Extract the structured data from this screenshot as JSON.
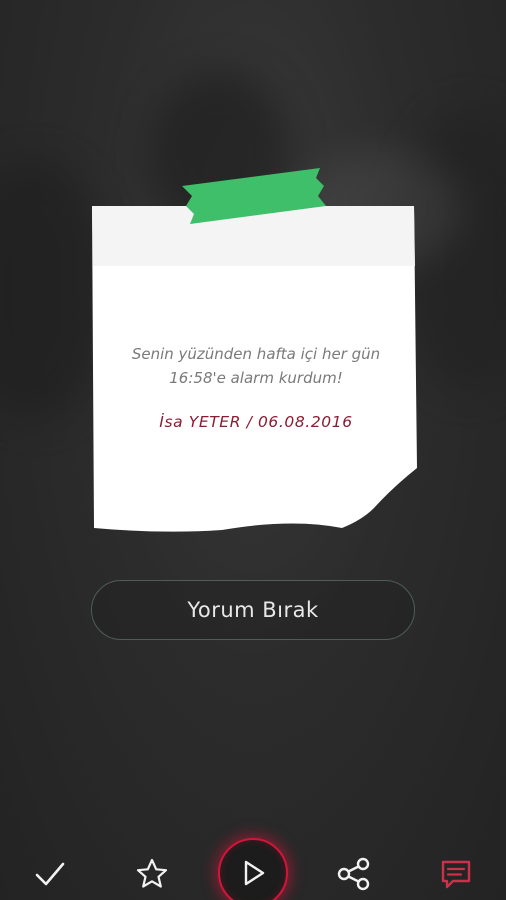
{
  "note": {
    "message_line1": "Senin yüzünden hafta içi her gün",
    "message_line2": "16:58'e alarm kurdum!",
    "author": "İsa YETER / 06.08.2016"
  },
  "comment_button": {
    "label": "Yorum Bırak"
  },
  "bottom_bar": {
    "icons": [
      "check-icon",
      "star-icon",
      "play-icon",
      "share-icon",
      "comment-icon"
    ]
  },
  "colors": {
    "accent_red": "#d3153a",
    "author_red": "#8b1c32",
    "tape_green": "#3fbf6a",
    "comment_icon_red": "#c8324a",
    "background": "#2c2c2c",
    "note_paper": "#ffffff",
    "note_top_band": "#f4f4f4"
  }
}
